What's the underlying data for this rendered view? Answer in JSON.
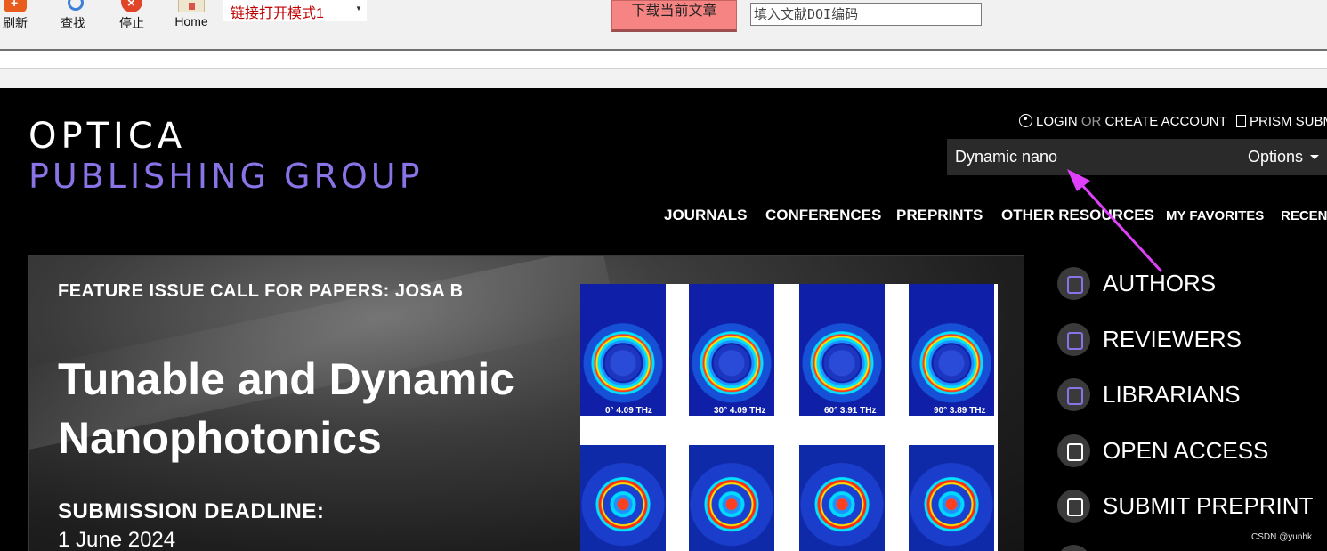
{
  "toolbar": {
    "refresh_label": "刷新",
    "find_label": "查找",
    "stop_label": "停止",
    "home_label": "Home",
    "mode_select_value": "链接打开模式1",
    "download_label": "下载当前文章",
    "doi_placeholder": "填入文献DOI编码"
  },
  "site": {
    "logo_top": "OPTICA",
    "logo_bottom": "PUBLISHING GROUP",
    "login": "LOGIN",
    "or": "OR",
    "create_account": "CREATE ACCOUNT",
    "prism": "PRISM SUBM",
    "search_value": "Dynamic nano",
    "options_label": "Options",
    "nav": [
      "JOURNALS",
      "CONFERENCES",
      "PREPRINTS",
      "OTHER RESOURCES",
      "MY FAVORITES",
      "RECENT"
    ],
    "hero": {
      "kicker": "FEATURE ISSUE CALL FOR PAPERS: JOSA B",
      "title": "Tunable and Dynamic Nanophotonics",
      "deadline_label": "SUBMISSION DEADLINE:",
      "deadline": "1 June 2024",
      "figure_captions": [
        "0°  4.09 THz",
        "30°  4.09 THz",
        "60°  3.91 THz",
        "90°  3.89 THz"
      ]
    },
    "side_menu": [
      "AUTHORS",
      "REVIEWERS",
      "LIBRARIANS",
      "OPEN ACCESS",
      "SUBMIT PREPRINT"
    ]
  },
  "colors": {
    "logo_accent": "#8a73e6",
    "download_button": "#f58482",
    "annotation_arrow": "#e040fb",
    "mode_select_text": "#c00000"
  },
  "watermark": "CSDN @yunhk"
}
